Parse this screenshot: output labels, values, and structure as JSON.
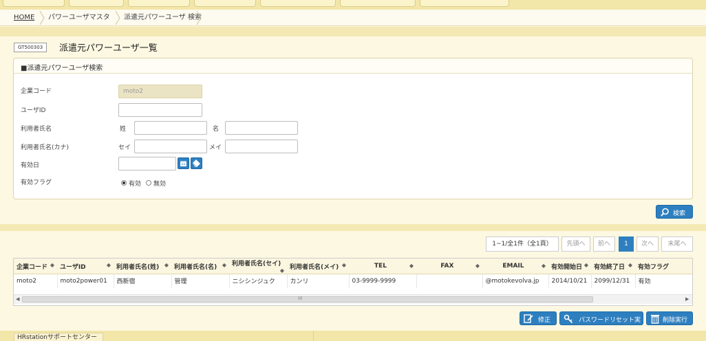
{
  "breadcrumb": {
    "home": "HOME",
    "master": "パワーユーザマスタ",
    "current": "派遣元パワーユーザ 検索"
  },
  "page": {
    "screen_id": "GT500303",
    "title": "派遣元パワーユーザ一覧"
  },
  "search": {
    "section_title": "■派遣元パワーユーザ検索",
    "company_code": {
      "label": "企業コード",
      "value": "moto2"
    },
    "user_id": {
      "label": "ユーザID",
      "value": ""
    },
    "user_name": {
      "label": "利用者氏名",
      "last_label": "姓",
      "last_value": "",
      "first_label": "名",
      "first_value": ""
    },
    "user_kana": {
      "label": "利用者氏名(カナ)",
      "last_label": "セイ",
      "last_value": "",
      "first_label": "メイ",
      "first_value": ""
    },
    "valid_date": {
      "label": "有効日",
      "value": ""
    },
    "valid_flag": {
      "label": "有効フラグ",
      "option_valid": "有効",
      "option_invalid": "無効",
      "selected": "有効"
    },
    "search_button": "検索"
  },
  "pager": {
    "summary": "1~1/全1件（全1頁）",
    "first": "先頭へ",
    "prev": "前へ",
    "current": "1",
    "next": "次へ",
    "last": "末尾へ"
  },
  "table": {
    "headers": [
      "企業コード",
      "ユーザID",
      "利用者氏名(姓)",
      "利用者氏名(名)",
      "利用者氏名(セイ)",
      "利用者氏名(メイ)",
      "TEL",
      "FAX",
      "EMAIL",
      "有効開始日",
      "有効終了日",
      "有効フラグ"
    ],
    "sort_mark": "◆",
    "rows": [
      [
        "moto2",
        "moto2power01",
        "西新宿",
        "管理",
        "ニシシンジュク",
        "カンリ",
        "03-9999-9999",
        "",
        "@motokevolva.jp",
        "2014/10/21",
        "2099/12/31",
        "有効"
      ]
    ],
    "scroll_mark": "III"
  },
  "actions": {
    "edit": "修正",
    "password_reset": "パスワードリセット実行",
    "delete": "削除実行"
  },
  "footer": {
    "support": "HRstationサポートセンター"
  },
  "colors": {
    "accent": "#2e7fbf",
    "header_bg": "#f2e6a8",
    "page_bg": "#fdf8e2"
  }
}
